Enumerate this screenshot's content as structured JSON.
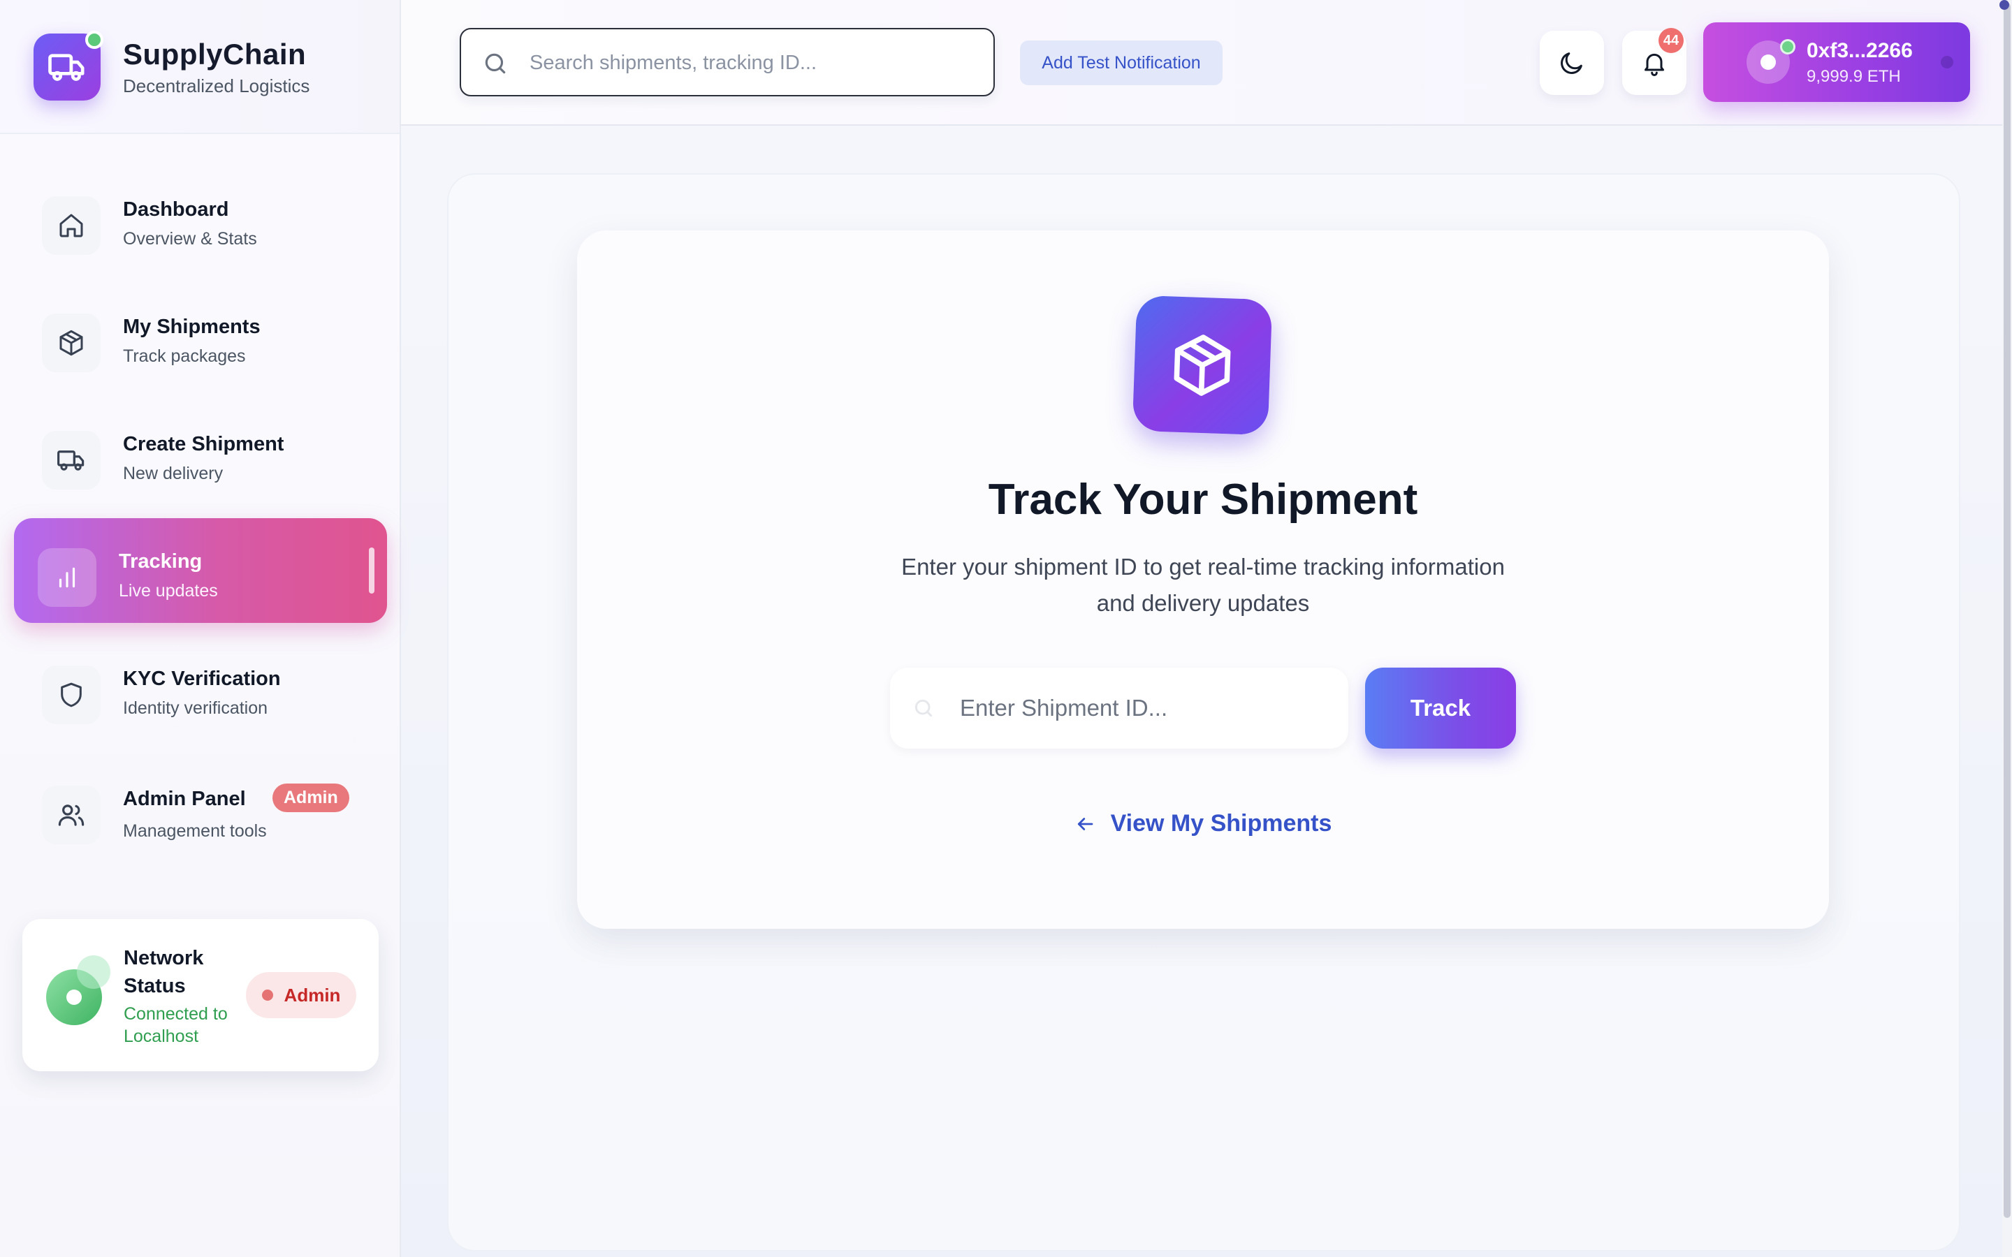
{
  "brand": {
    "title": "SupplyChain",
    "subtitle": "Decentralized Logistics"
  },
  "nav": {
    "items": [
      {
        "title": "Dashboard",
        "sub": "Overview & Stats",
        "icon": "home-icon"
      },
      {
        "title": "My Shipments",
        "sub": "Track packages",
        "icon": "package-icon"
      },
      {
        "title": "Create Shipment",
        "sub": "New delivery",
        "icon": "truck-icon"
      },
      {
        "title": "Tracking",
        "sub": "Live updates",
        "icon": "bar-chart-icon",
        "active": true
      },
      {
        "title": "KYC Verification",
        "sub": "Identity verification",
        "icon": "shield-icon"
      },
      {
        "title": "Admin Panel",
        "sub": "Management tools",
        "icon": "users-icon",
        "badge": "Admin"
      }
    ]
  },
  "network": {
    "title": "Network Status",
    "status": "Connected to Localhost",
    "badge": "Admin"
  },
  "topbar": {
    "search_placeholder": "Search shipments, tracking ID...",
    "test_notification_label": "Add Test Notification",
    "notification_count": "44"
  },
  "wallet": {
    "address": "0xf3...2266",
    "balance": "9,999.9 ETH"
  },
  "main": {
    "title": "Track Your Shipment",
    "description": "Enter your shipment ID to get real-time tracking information and delivery updates",
    "input_placeholder": "Enter Shipment ID...",
    "track_button": "Track",
    "view_link": "View My Shipments"
  },
  "colors": {
    "accent": "#7c3ae0",
    "active_nav_start": "#b26af0",
    "active_nav_end": "#e0548f",
    "link": "#3552c8",
    "success": "#2f9e4f",
    "danger": "#c62828"
  }
}
